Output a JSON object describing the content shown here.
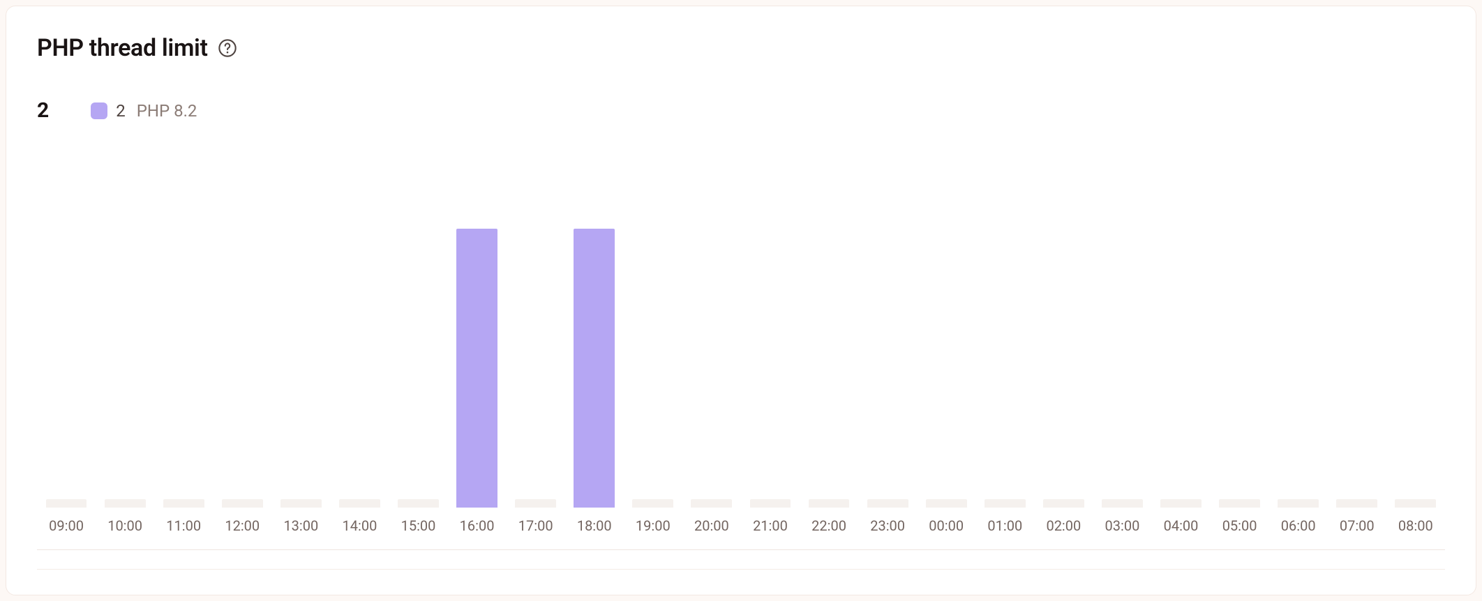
{
  "title": "PHP thread limit",
  "total": "2",
  "legend": {
    "swatch_color": "#b5a6f3",
    "value": "2",
    "label": "PHP 8.2"
  },
  "chart_data": {
    "type": "bar",
    "title": "PHP thread limit",
    "xlabel": "",
    "ylabel": "",
    "ylim": [
      0,
      1
    ],
    "categories": [
      "09:00",
      "10:00",
      "11:00",
      "12:00",
      "13:00",
      "14:00",
      "15:00",
      "16:00",
      "17:00",
      "18:00",
      "19:00",
      "20:00",
      "21:00",
      "22:00",
      "23:00",
      "00:00",
      "01:00",
      "02:00",
      "03:00",
      "04:00",
      "05:00",
      "06:00",
      "07:00",
      "08:00"
    ],
    "series": [
      {
        "name": "PHP 8.2",
        "color": "#b5a6f3",
        "values": [
          0.03,
          0.03,
          0.03,
          0.03,
          0.03,
          0.03,
          0.03,
          1,
          0.03,
          1,
          0.03,
          0.03,
          0.03,
          0.03,
          0.03,
          0.03,
          0.03,
          0.03,
          0.03,
          0.03,
          0.03,
          0.03,
          0.03,
          0.03
        ]
      }
    ],
    "baseline_color": "#f5f1ee"
  }
}
